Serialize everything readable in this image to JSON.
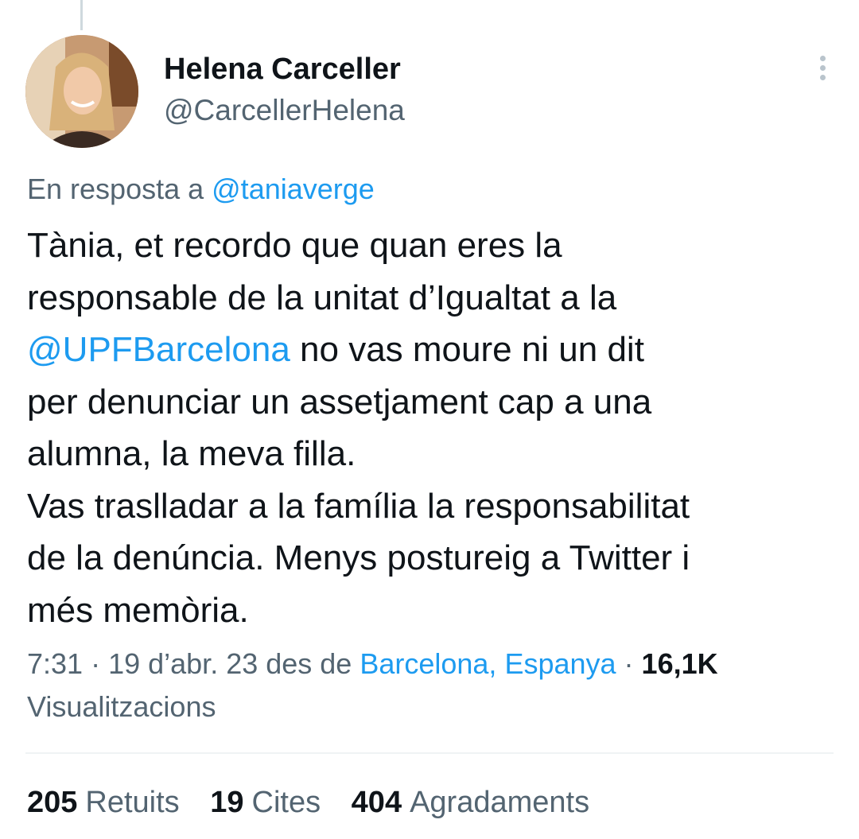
{
  "author": {
    "name": "Helena Carceller",
    "handle": "@CarcellerHelena"
  },
  "reply": {
    "prefix": "En resposta a ",
    "mention": "@taniaverge"
  },
  "tweet": {
    "line1": "Tània, et recordo que quan eres  la",
    "line2": "responsable de la unitat d’Igualtat a la",
    "line3_mention": "@UPFBarcelona",
    "line3_rest": " no vas moure ni un dit",
    "line4": "per denunciar un assetjament cap a una",
    "line5": "alumna, la meva filla.",
    "line6": "Vas traslladar a la família la responsabilitat",
    "line7": "de la denúncia. Menys postureig a Twitter i",
    "line8": "més memòria."
  },
  "meta": {
    "time": "7:31",
    "sep1": " · ",
    "date": "19 d’abr. 23",
    "from_label": " des de ",
    "location": "Barcelona, Espanya",
    "sep2": " · ",
    "views_count": "16,1K",
    "views_label": "Visualitzacions"
  },
  "stats": {
    "retweets_count": "205",
    "retweets_label": "Retuits",
    "quotes_count": "19",
    "quotes_label": "Cites",
    "likes_count": "404",
    "likes_label": "Agradaments"
  },
  "colors": {
    "link": "#1d9bf0",
    "secondary_text": "#536471",
    "primary_text": "#0f1419"
  },
  "icons": {
    "more": "more-vertical-icon"
  }
}
